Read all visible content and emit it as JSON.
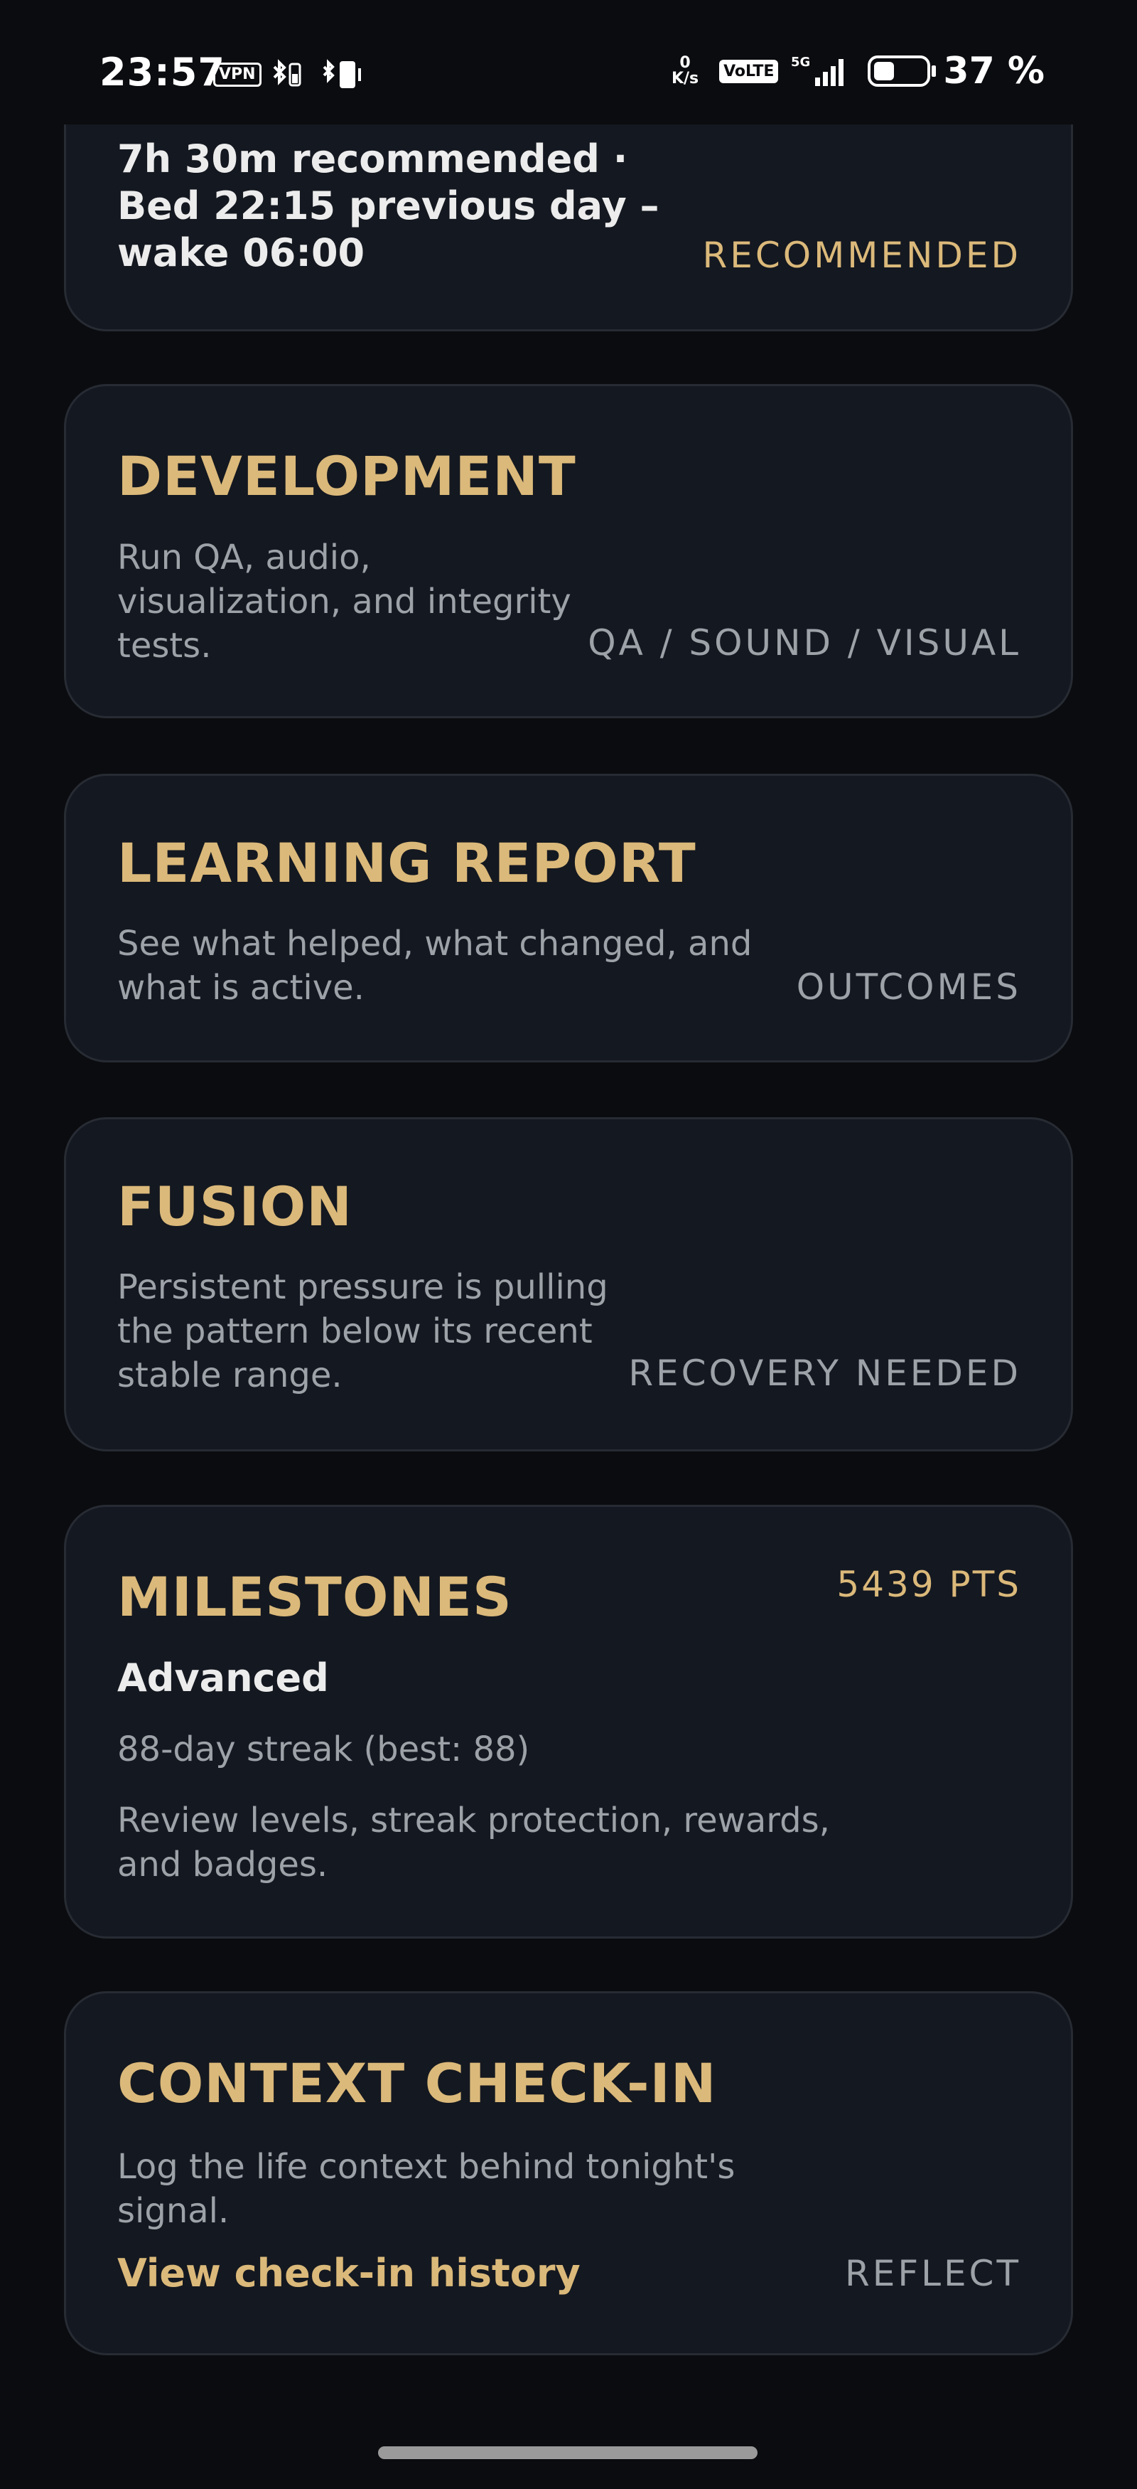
{
  "status_bar": {
    "time": "23:57",
    "vpn": "VPN",
    "net_speed_value": "0",
    "net_speed_unit": "K/s",
    "volte": "VoLTE",
    "network": "5G",
    "battery_pct": "37 %"
  },
  "sleep_card": {
    "text": "7h 30m recommended ·\nBed 22:15 previous day –\nwake 06:00",
    "tag": "RECOMMENDED"
  },
  "development_card": {
    "title": "DEVELOPMENT",
    "desc": "Run QA, audio,\nvisualization, and integrity\ntests.",
    "tag": "QA / SOUND / VISUAL"
  },
  "learning_card": {
    "title": "LEARNING REPORT",
    "desc": "See what helped, what changed, and\nwhat is active.",
    "tag": "OUTCOMES"
  },
  "fusion_card": {
    "title": "FUSION",
    "desc": "Persistent pressure is pulling\nthe pattern below its recent\nstable range.",
    "tag": "RECOVERY NEEDED"
  },
  "milestones_card": {
    "title": "MILESTONES",
    "points": "5439 PTS",
    "level": "Advanced",
    "streak": "88-day streak (best: 88)",
    "desc": "Review levels, streak protection, rewards,\nand badges."
  },
  "context_card": {
    "title": "CONTEXT CHECK-IN",
    "desc": "Log the life context behind tonight's\nsignal.",
    "link": "View check-in history",
    "tag": "REFLECT"
  },
  "colors": {
    "background": "#0b0c0f",
    "card": "#141820",
    "accent_gold": "#dbb97a",
    "muted_text": "#9da1a8"
  }
}
